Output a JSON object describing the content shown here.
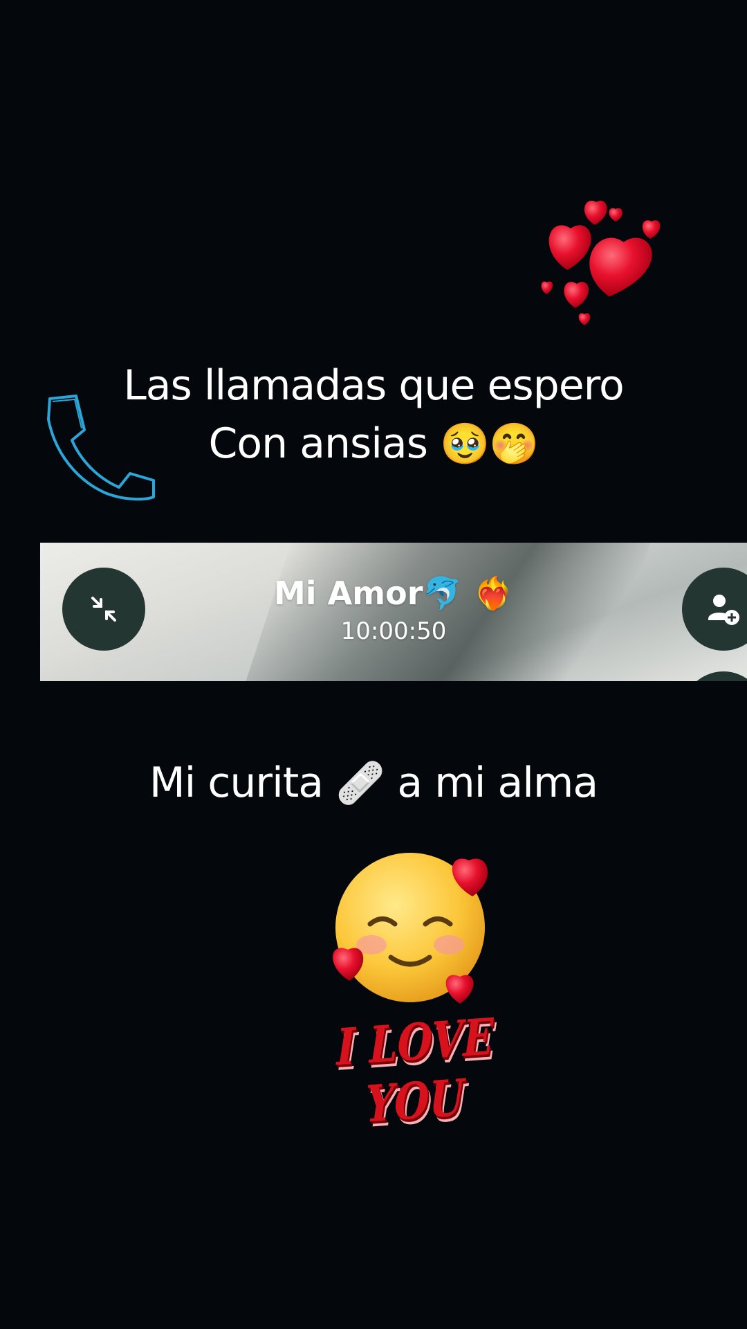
{
  "caption_top": {
    "line1": "Las llamadas que espero",
    "line2": "Con ansias",
    "line2_emojis": "🥹🤭"
  },
  "call": {
    "contact_name": "Mi Amor",
    "name_emojis": "🐬 ❤️‍🔥",
    "timer": "10:00:50",
    "minimize_icon": "minimize-arrows-icon",
    "add_person_icon": "add-person-icon"
  },
  "caption_middle": {
    "text_before": "Mi curita",
    "emoji": "🩹",
    "text_after": "a mi alma"
  },
  "sticker": {
    "face_emoji": "🥰",
    "love_text": "I LOVE YOU"
  },
  "colors": {
    "background": "#04070b",
    "heart_red": "#e8112d",
    "phone_outline": "#2aa7d8",
    "button_dark": "#243632"
  }
}
